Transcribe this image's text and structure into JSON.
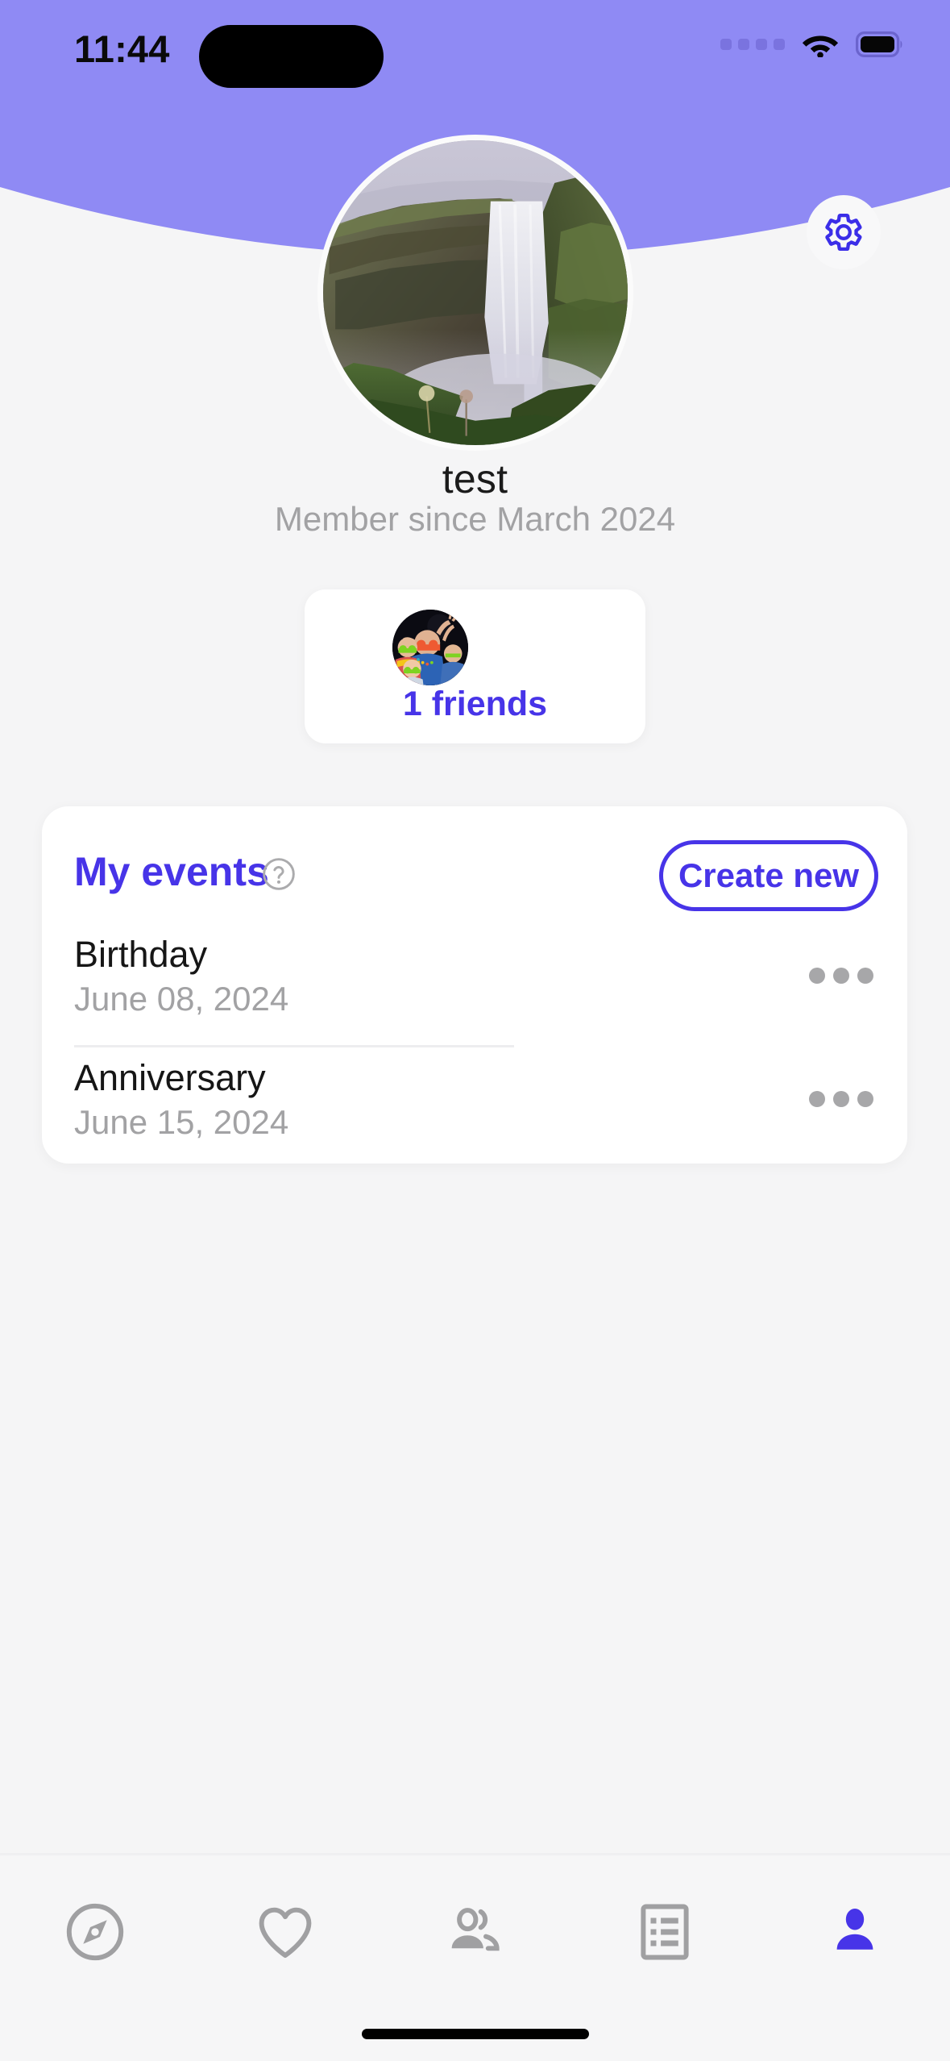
{
  "status_bar": {
    "time": "11:44",
    "signal_icon": "signal-dots-icon",
    "wifi_icon": "wifi-icon",
    "battery_icon": "battery-full-icon"
  },
  "header": {
    "background_color": "#8F8AF4",
    "settings_icon": "gear-icon",
    "settings_icon_color": "#3B2EE8"
  },
  "profile": {
    "avatar_alt": "waterfall-profile-photo",
    "name": "test",
    "member_since": "Member since March 2024"
  },
  "friends_card": {
    "avatar_alt": "friends-group-photo",
    "count_label": "1 friends",
    "count_color": "#4734E8"
  },
  "events": {
    "title": "My events",
    "help_icon": "question-circle-icon",
    "create_button": "Create new",
    "accent_color": "#4734E8",
    "items": [
      {
        "title": "Birthday",
        "date": "June 08, 2024",
        "menu_icon": "more-horizontal-icon"
      },
      {
        "title": "Anniversary",
        "date": "June 15, 2024",
        "menu_icon": "more-horizontal-icon"
      }
    ]
  },
  "tabbar": {
    "active_color": "#4734E8",
    "inactive_color": "#A0A0A2",
    "items": [
      {
        "name": "explore",
        "icon": "compass-icon",
        "active": false
      },
      {
        "name": "favorites",
        "icon": "heart-icon",
        "active": false
      },
      {
        "name": "friends",
        "icon": "people-icon",
        "active": false
      },
      {
        "name": "list",
        "icon": "list-icon",
        "active": false
      },
      {
        "name": "profile",
        "icon": "person-icon",
        "active": true
      }
    ]
  }
}
